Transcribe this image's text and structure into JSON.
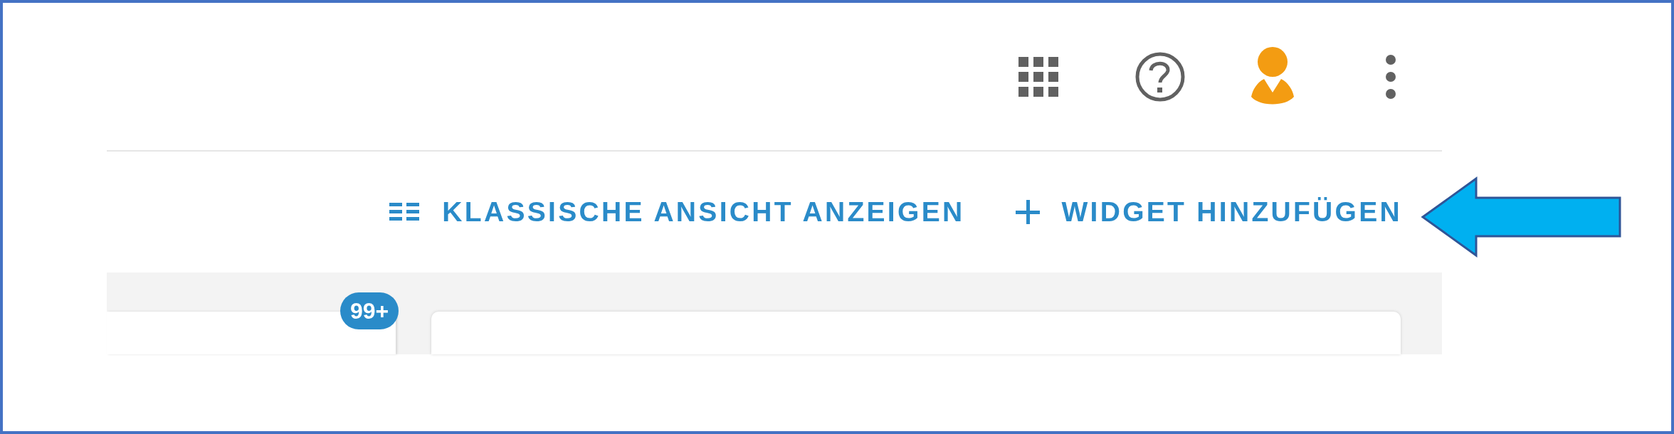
{
  "actions": [
    {
      "kind": "list",
      "label": "KLASSISCHE ANSICHT ANZEIGEN"
    },
    {
      "kind": "plus",
      "label": "WIDGET HINZUFÜGEN"
    }
  ],
  "sidebar": {
    "badge": "99+"
  }
}
